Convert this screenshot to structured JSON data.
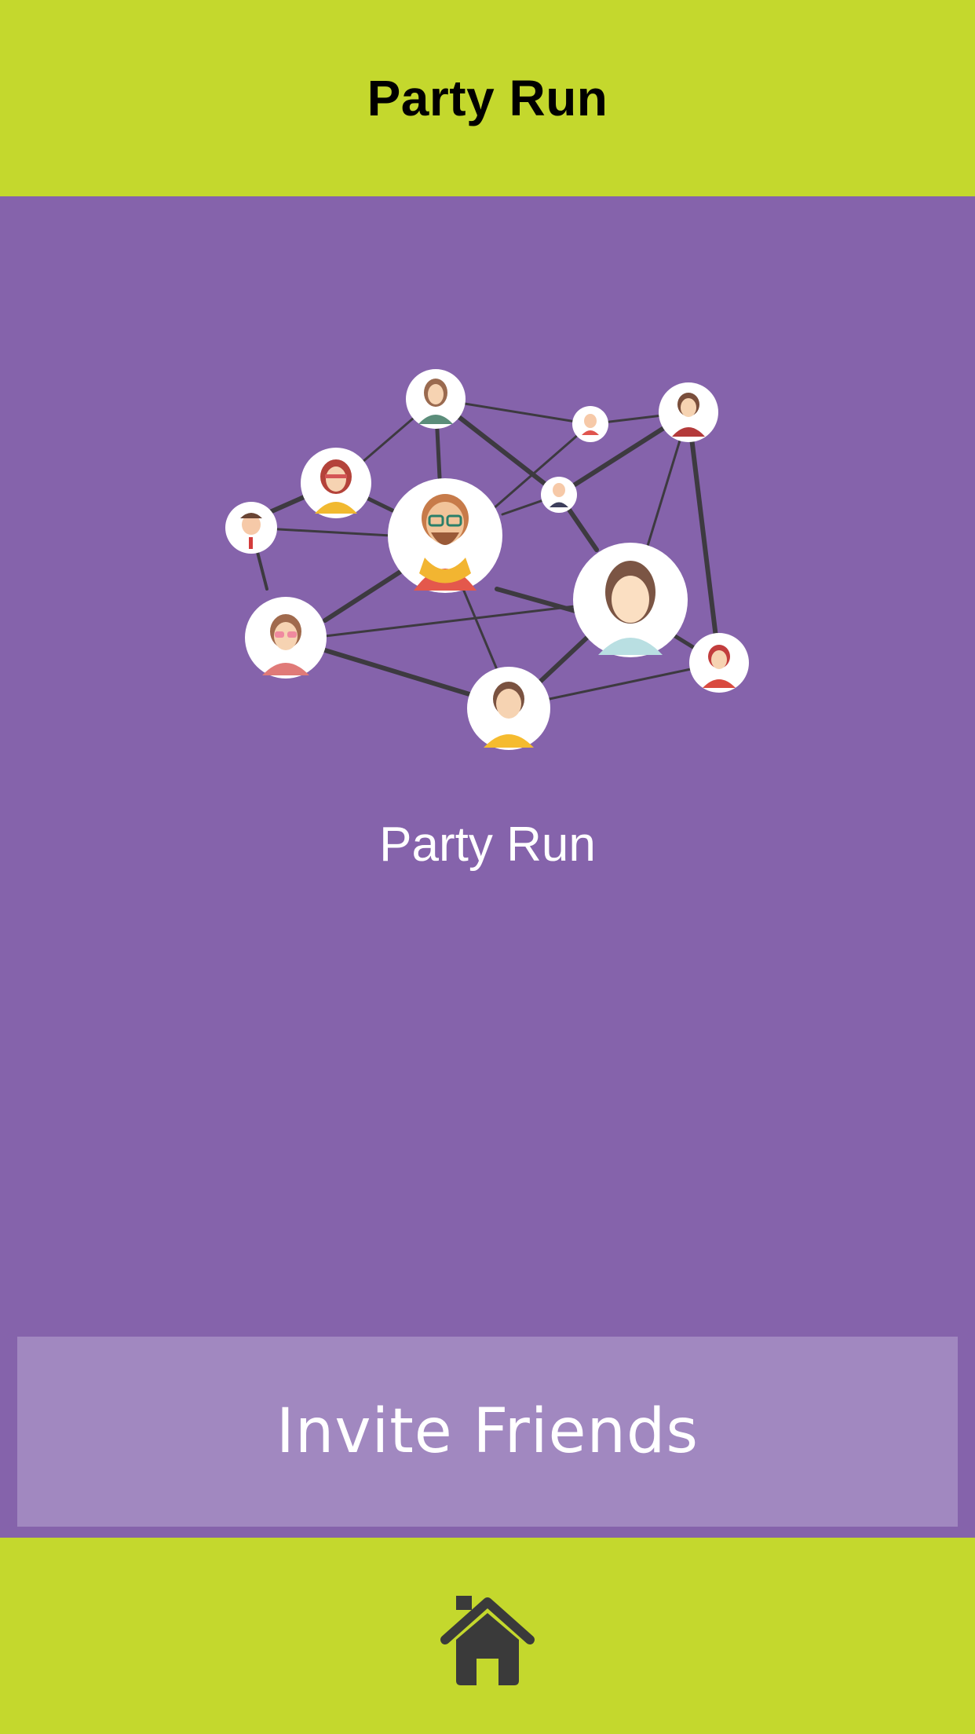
{
  "header": {
    "title": "Party Run"
  },
  "main": {
    "subtitle": "Party Run",
    "invite_button_label": "Invite Friends"
  },
  "footer": {
    "home_icon": "home-icon"
  },
  "colors": {
    "bar": "#c4d82d",
    "background": "#8563ab",
    "button": "#a188c0",
    "icon": "#3a3a3a"
  }
}
